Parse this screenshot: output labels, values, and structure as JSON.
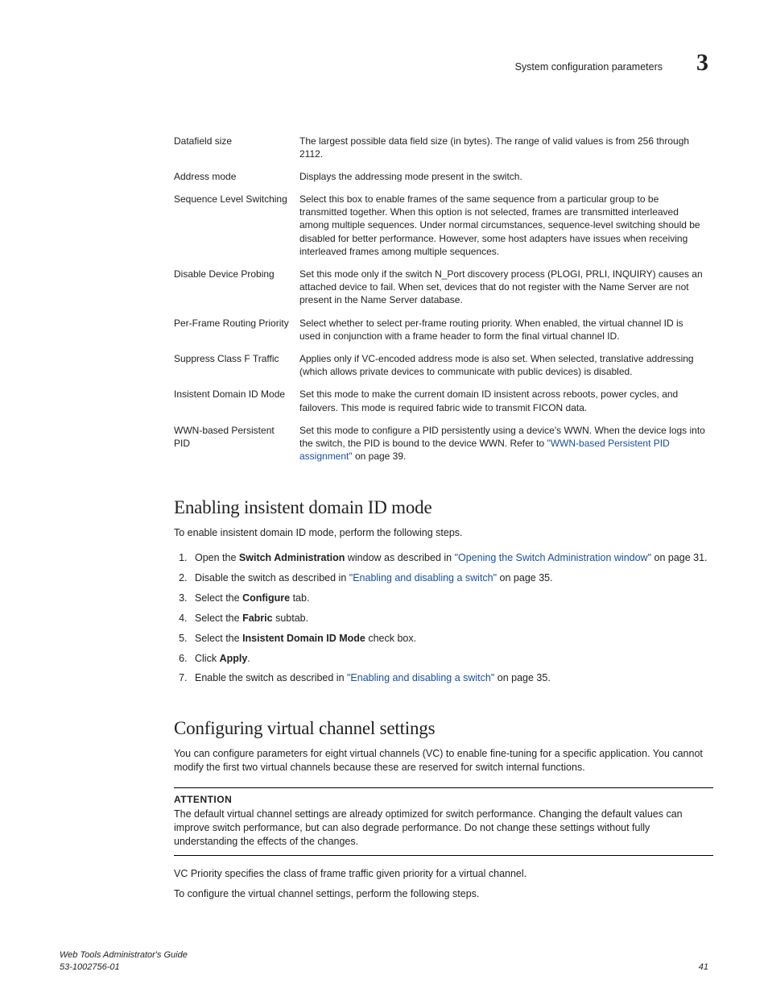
{
  "header": {
    "section_name": "System configuration parameters",
    "chapter_number": "3"
  },
  "table": {
    "rows": [
      {
        "label": "Datafield size",
        "desc_plain": "The largest possible data field size (in bytes). The range of valid values is from 256 through 2112."
      },
      {
        "label": "Address mode",
        "desc_plain": "Displays the addressing mode present in the switch."
      },
      {
        "label": "Sequence Level Switching",
        "desc_plain": "Select this box to enable frames of the same sequence from a particular group to be transmitted together. When this option is not selected, frames are transmitted interleaved among multiple sequences. Under normal circumstances, sequence-level switching should be disabled for better performance. However, some host adapters have issues when receiving interleaved frames among multiple sequences."
      },
      {
        "label": "Disable Device Probing",
        "desc_plain": "Set this mode only if the switch N_Port discovery process (PLOGI, PRLI, INQUIRY) causes an attached device to fail. When set, devices that do not register with the Name Server are not present in the Name Server database."
      },
      {
        "label": "Per-Frame Routing Priority",
        "desc_plain": "Select whether to select per-frame routing priority. When enabled, the virtual channel ID is used in conjunction with a frame header to form the final virtual channel ID."
      },
      {
        "label": "Suppress Class F Traffic",
        "desc_plain": "Applies only if VC-encoded address mode is also set. When selected, translative addressing (which allows private devices to communicate with public devices) is disabled."
      },
      {
        "label": "Insistent Domain ID Mode",
        "desc_plain": "Set this mode to make the current domain ID insistent across reboots, power cycles, and failovers. This mode is required fabric wide to transmit FICON data."
      },
      {
        "label": "WWN-based Persistent PID",
        "desc_pre": "Set this mode to configure a PID persistently using a device's WWN. When the device logs into the switch, the PID is bound to the device WWN. Refer to ",
        "desc_link": "\"WWN-based Persistent PID assignment\"",
        "desc_post": " on page 39."
      }
    ]
  },
  "section1": {
    "heading": "Enabling insistent domain ID mode",
    "intro": "To enable insistent domain ID mode, perform the following steps.",
    "steps": {
      "s1_pre": "Open the ",
      "s1_bold": "Switch Administration",
      "s1_mid": " window as described in ",
      "s1_link": "\"Opening the Switch Administration window\"",
      "s1_post": " on page 31.",
      "s2_pre": "Disable the switch as described in ",
      "s2_link": "\"Enabling and disabling a switch\"",
      "s2_post": " on page 35.",
      "s3_pre": "Select the ",
      "s3_bold": "Configure",
      "s3_post": " tab.",
      "s4_pre": "Select the ",
      "s4_bold": "Fabric",
      "s4_post": " subtab.",
      "s5_pre": "Select the ",
      "s5_bold": "Insistent Domain ID Mode",
      "s5_post": " check box.",
      "s6_pre": "Click ",
      "s6_bold": "Apply",
      "s6_post": ".",
      "s7_pre": "Enable the switch as described in ",
      "s7_link": "\"Enabling and disabling a switch\"",
      "s7_post": " on page 35."
    }
  },
  "section2": {
    "heading": "Configuring virtual channel settings",
    "intro": "You can configure parameters for eight virtual channels (VC) to enable fine-tuning for a specific application. You cannot modify the first two virtual channels because these are reserved for switch internal functions.",
    "attention_title": "ATTENTION",
    "attention_body": "The default virtual channel settings are already optimized for switch performance. Changing the default values can improve switch performance, but can also degrade performance. Do not change these settings without fully understanding the effects of the changes.",
    "p1": "VC Priority specifies the class of frame traffic given priority for a virtual channel.",
    "p2": "To configure the virtual channel settings, perform the following steps."
  },
  "footer": {
    "doc_title": "Web Tools Administrator's Guide",
    "doc_number": "53-1002756-01",
    "page": "41"
  }
}
